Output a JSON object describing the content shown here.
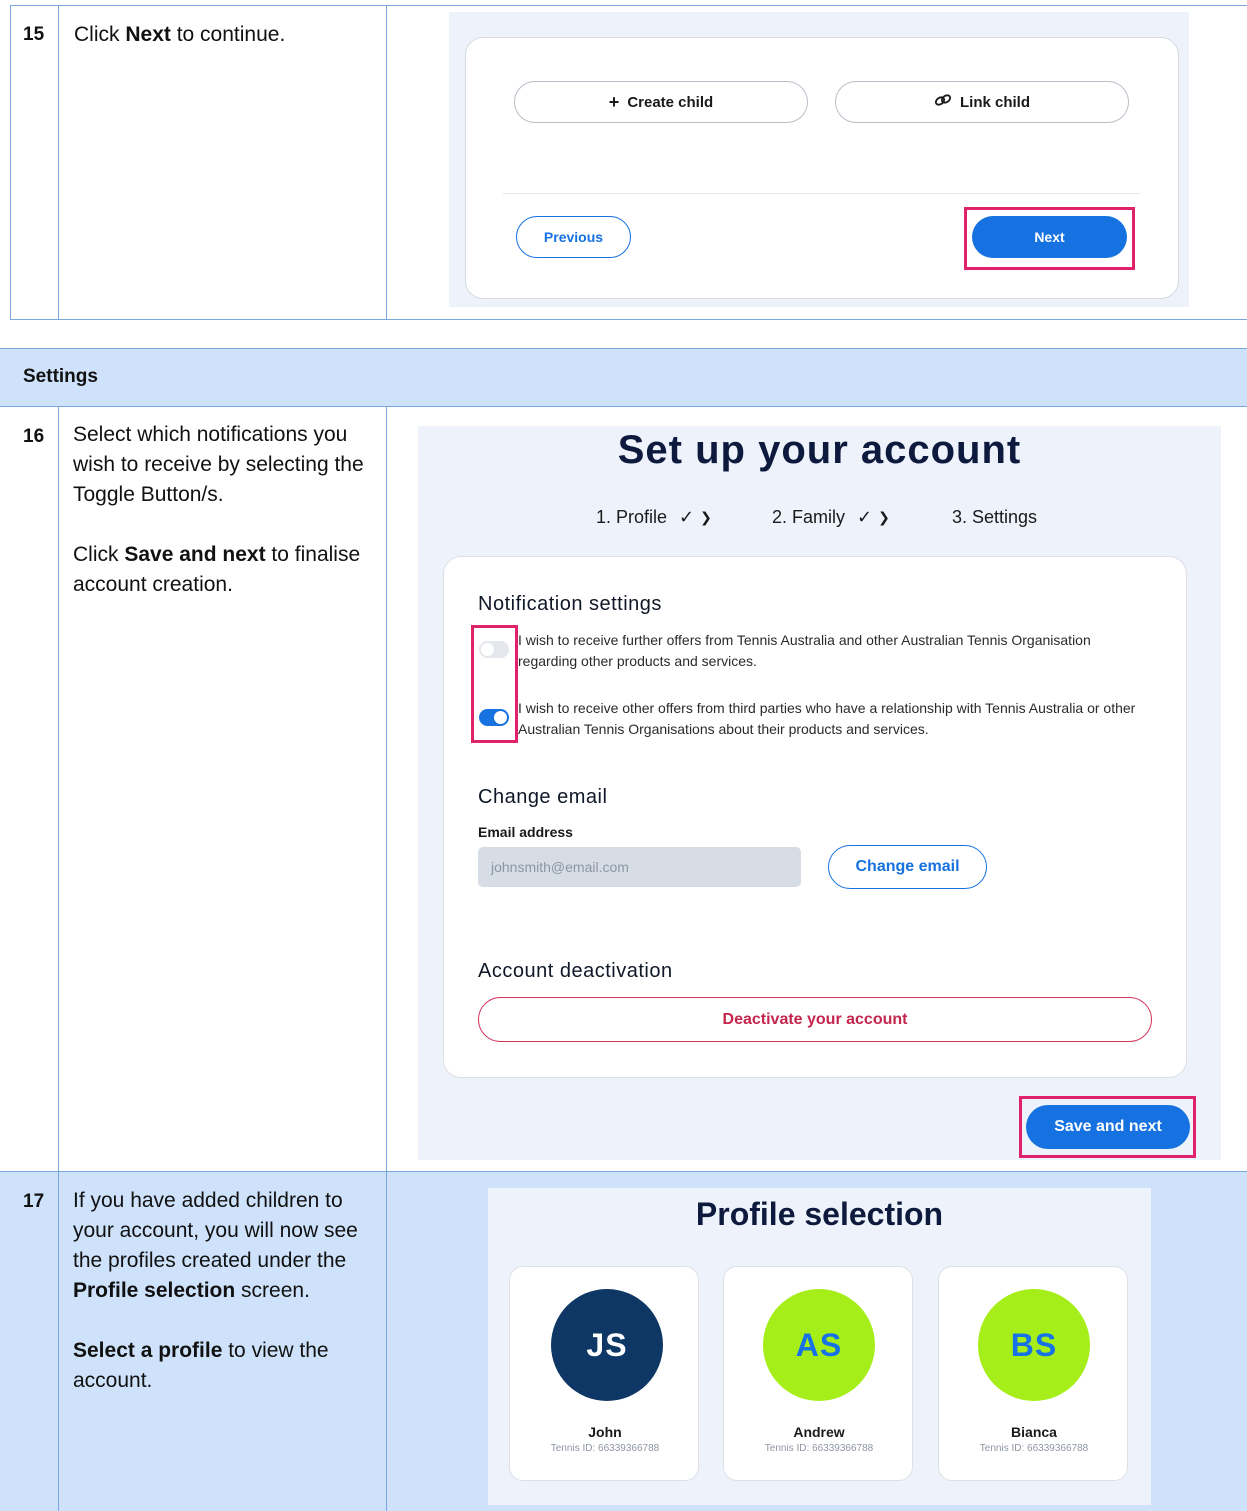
{
  "step15": {
    "number": "15",
    "text_prefix": "Click ",
    "text_bold": "Next",
    "text_suffix": " to continue.",
    "screenshot": {
      "create_child": "Create child",
      "link_child": "Link child",
      "previous": "Previous",
      "next": "Next"
    }
  },
  "settings_header": "Settings",
  "step16": {
    "number": "16",
    "instruction1": "Select which notifications you wish to receive by selecting the Toggle Button/s.",
    "instruction2_prefix": "Click ",
    "instruction2_bold": "Save and next",
    "instruction2_suffix": " to finalise account creation.",
    "screenshot": {
      "title": "Set up your account",
      "steps": [
        {
          "label": "1.  Profile",
          "check": "✓",
          "arrow": "❯"
        },
        {
          "label": "2.  Family",
          "check": "✓",
          "arrow": "❯"
        },
        {
          "label": "3.  Settings"
        }
      ],
      "notification_heading": "Notification settings",
      "notifications": [
        {
          "text": "I wish to receive further offers from Tennis Australia and other Australian Tennis Organisation regarding other products and services.",
          "enabled": false
        },
        {
          "text": "I wish to receive other offers from third parties who have a relationship with Tennis Australia or other Australian Tennis Organisations about their products and services.",
          "enabled": true
        }
      ],
      "change_email_heading": "Change email",
      "email_label": "Email address",
      "email_placeholder": "johnsmith@email.com",
      "change_email_button": "Change email",
      "deactivation_heading": "Account deactivation",
      "deactivate_button": "Deactivate your account",
      "save_next_button": "Save and next"
    }
  },
  "step17": {
    "number": "17",
    "text1_prefix": "If you have added children to your account, you will now see the profiles created under the ",
    "text1_bold": "Profile selection",
    "text1_suffix": " screen.",
    "text2_bold": "Select a profile",
    "text2_suffix": " to view the account.",
    "screenshot": {
      "title": "Profile selection",
      "profiles": [
        {
          "initials": "JS",
          "name": "John",
          "tennis_id": "Tennis ID: 66339366788",
          "avatar_bg": "#0e3766",
          "avatar_fg": "#ffffff"
        },
        {
          "initials": "AS",
          "name": "Andrew",
          "tennis_id": "Tennis ID: 66339366788",
          "avatar_bg": "#a6ee1a",
          "avatar_fg": "#1772e8"
        },
        {
          "initials": "BS",
          "name": "Bianca",
          "tennis_id": "Tennis ID: 66339366788",
          "avatar_bg": "#a6ee1a",
          "avatar_fg": "#1772e8"
        }
      ]
    }
  },
  "colors": {
    "accent_blue": "#1672e0",
    "highlight": "#e0226b",
    "band": "#cfe2fb",
    "danger": "#c4254c"
  }
}
